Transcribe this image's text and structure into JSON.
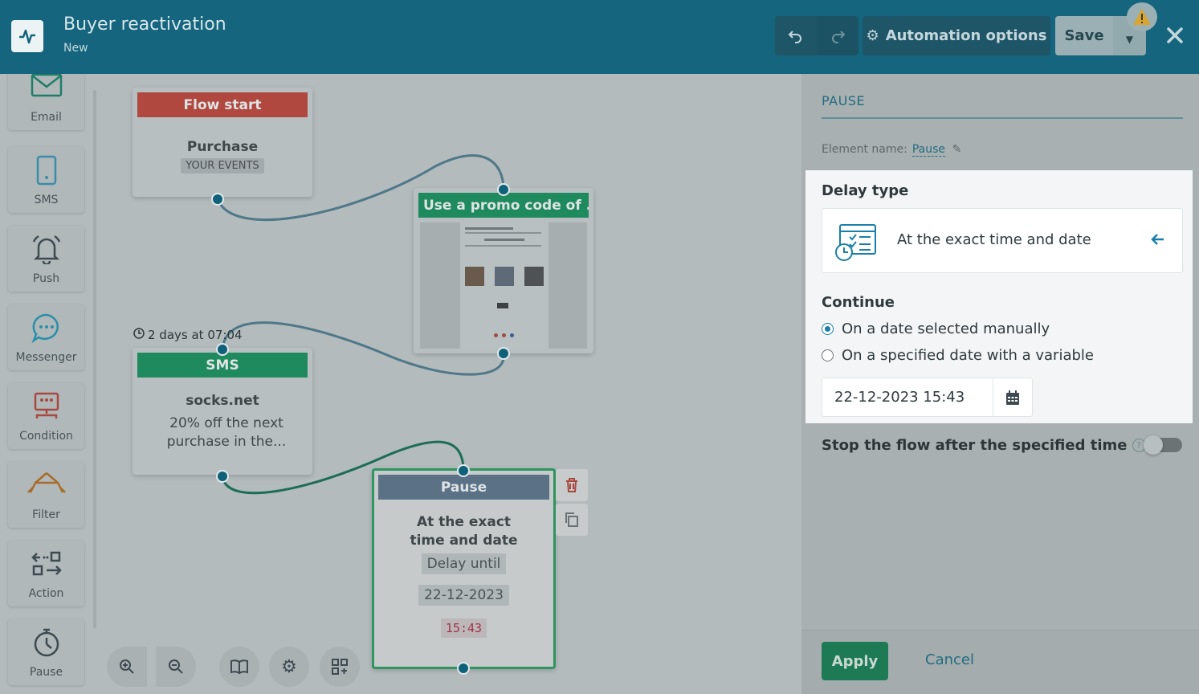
{
  "header": {
    "title": "Buyer reactivation",
    "subtitle": "New",
    "automation_options_label": "Automation options",
    "save_label": "Save"
  },
  "sidebar": {
    "items": [
      {
        "label": "Email",
        "icon": "email-icon"
      },
      {
        "label": "SMS",
        "icon": "phone-icon"
      },
      {
        "label": "Push",
        "icon": "bell-icon"
      },
      {
        "label": "Messenger",
        "icon": "chat-icon"
      },
      {
        "label": "Condition",
        "icon": "condition-icon"
      },
      {
        "label": "Filter",
        "icon": "filter-icon"
      },
      {
        "label": "Action",
        "icon": "action-icon"
      },
      {
        "label": "Pause",
        "icon": "stopwatch-icon"
      }
    ]
  },
  "canvas": {
    "flow_start": {
      "title": "Flow start",
      "event": "Purchase",
      "tag": "YOUR EVENTS"
    },
    "email": {
      "title": "Use a promo code of ..."
    },
    "sms": {
      "delay": "2 days at 07:04",
      "title": "SMS",
      "sender": "socks.net",
      "text": "20% off the next purchase in the..."
    },
    "pause": {
      "title": "Pause",
      "desc": "At the exact time and date",
      "delay_label": "Delay until",
      "date": "22-12-2023",
      "time": "15:43"
    }
  },
  "panel": {
    "title": "PAUSE",
    "element_name_label": "Element name:",
    "element_name_value": "Pause",
    "delay_type_heading": "Delay type",
    "delay_type_value": "At the exact time and date",
    "continue_heading": "Continue",
    "options": [
      {
        "label": "On a date selected manually",
        "selected": true
      },
      {
        "label": "On a specified date with a variable",
        "selected": false
      }
    ],
    "date_value": "22-12-2023 15:43",
    "stop_label": "Stop the flow after the specified time",
    "apply_label": "Apply",
    "cancel_label": "Cancel"
  },
  "colors": {
    "header": "#14657d",
    "flow_start_head": "#b04840",
    "email_head": "#1f8a5e",
    "pause_head": "#5a7186",
    "accent": "#1a7fa8"
  }
}
